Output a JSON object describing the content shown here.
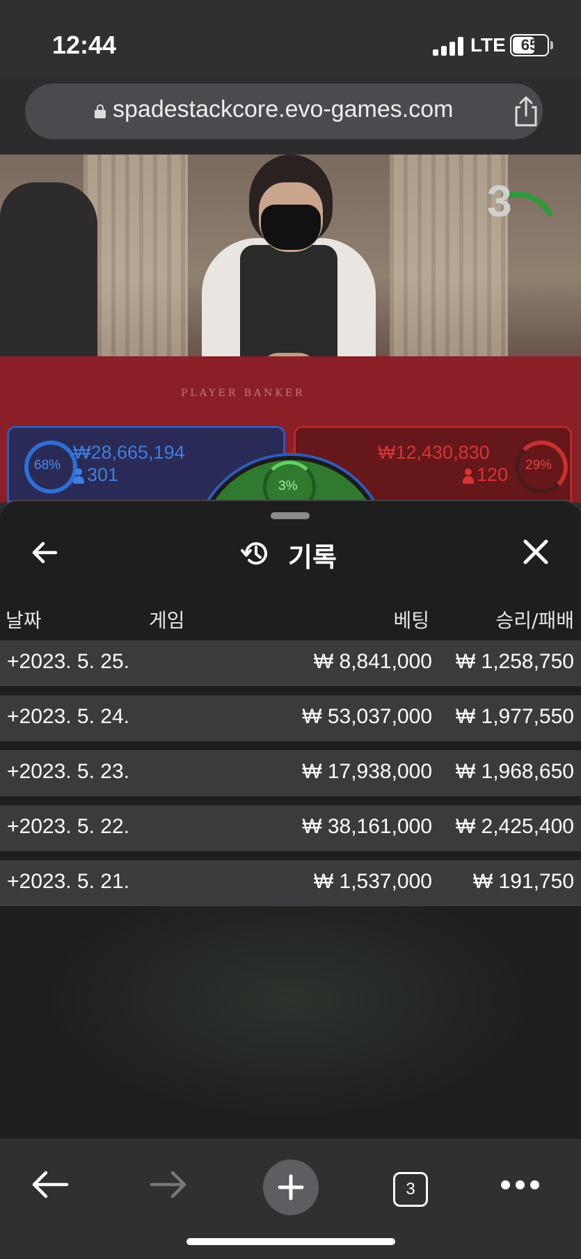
{
  "status_bar": {
    "time": "12:44",
    "network": "LTE",
    "battery": "65",
    "battery_level": 0.65
  },
  "browser": {
    "url": "spadestackcore.evo-games.com",
    "icons": [
      "lock-icon",
      "share-icon"
    ]
  },
  "game": {
    "countdown": "3",
    "table_label": "PLAYER  BANKER",
    "player": {
      "percent": "68%",
      "amount": "₩28,665,194",
      "bettors": "301",
      "color": "#2f6ed4"
    },
    "banker": {
      "percent": "29%",
      "amount": "₩12,430,830",
      "bettors": "120",
      "color": "#c83030"
    },
    "tie": {
      "percent": "3%",
      "color": "#2f7a2f"
    }
  },
  "history": {
    "title": "기록",
    "columns": {
      "date": "날짜",
      "game": "게임",
      "bet": "베팅",
      "result": "승리/패배"
    },
    "rows": [
      {
        "date": "+2023. 5. 25.",
        "bet": "₩ 8,841,000",
        "result": "₩ 1,258,750"
      },
      {
        "date": "+2023. 5. 24.",
        "bet": "₩ 53,037,000",
        "result": "₩ 1,977,550"
      },
      {
        "date": "+2023. 5. 23.",
        "bet": "₩ 17,938,000",
        "result": "₩ 1,968,650"
      },
      {
        "date": "+2023. 5. 22.",
        "bet": "₩ 38,161,000",
        "result": "₩ 2,425,400"
      },
      {
        "date": "+2023. 5. 21.",
        "bet": "₩ 1,537,000",
        "result": "₩ 191,750"
      }
    ]
  },
  "toolbar": {
    "tab_count": "3",
    "icons": [
      "back-arrow-icon",
      "forward-arrow-icon",
      "plus-icon",
      "tabs-icon",
      "more-icon"
    ]
  }
}
